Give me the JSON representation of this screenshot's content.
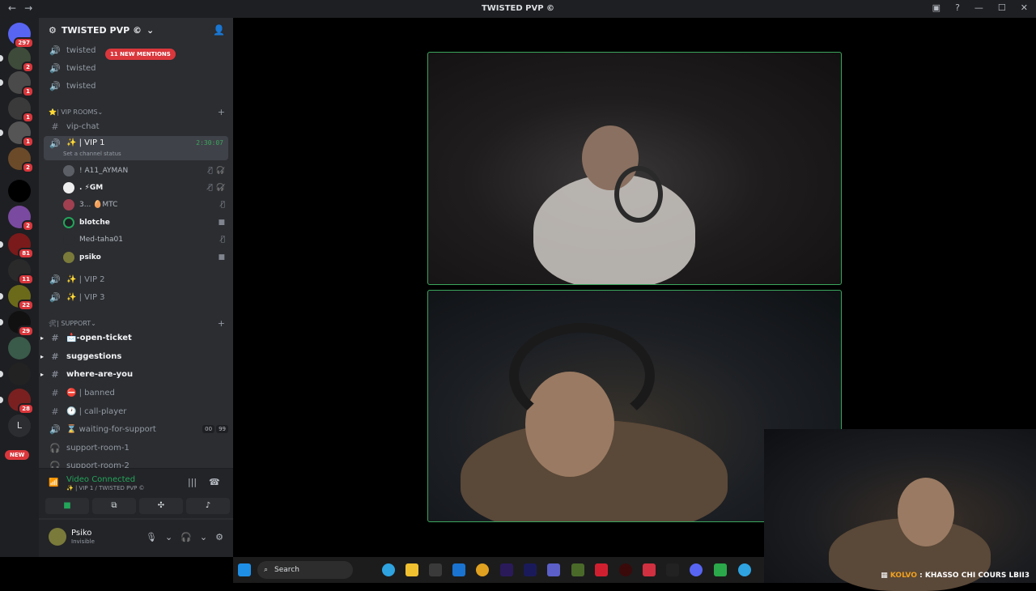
{
  "window": {
    "title": "TWISTED PVP ©"
  },
  "servers": [
    {
      "badge": "297"
    },
    {
      "badge": "2"
    },
    {
      "badge": "1"
    },
    {
      "badge": "1"
    },
    {
      "badge": "1"
    },
    {
      "badge": "2"
    },
    {
      "badge": ""
    },
    {
      "badge": "2"
    },
    {
      "badge": "81"
    },
    {
      "badge": "11"
    },
    {
      "badge": "22"
    },
    {
      "badge": "29"
    },
    {
      "badge": ""
    },
    {
      "badge": ""
    },
    {
      "badge": "28"
    }
  ],
  "rail": {
    "letter": "L",
    "new_label": "NEW"
  },
  "guild": {
    "name": "TWISTED PVP ©"
  },
  "mentions": "11 NEW MENTIONS",
  "channels_top": [
    "twisted",
    "twisted",
    "twisted"
  ],
  "vip_category": "⭐| VIP ROOMS",
  "vip_chat": "vip-chat",
  "vip1": {
    "name": "✨ | VIP 1",
    "status": "Set a channel status",
    "timer": "2:30:07"
  },
  "members": [
    {
      "name": "! A11_AYMAN"
    },
    {
      "name": ". ⚡GM"
    },
    {
      "name": "3... 🥚MTC"
    },
    {
      "name": "blotche"
    },
    {
      "name": "Med-taha01"
    },
    {
      "name": "psiko"
    }
  ],
  "vip_rooms": [
    "✨ | VIP 2",
    "✨ | VIP 3"
  ],
  "support_category": "🛠| SUPPORT",
  "support_channels": [
    {
      "name": "📩-open-ticket"
    },
    {
      "name": "suggestions"
    },
    {
      "name": "where-are-you"
    },
    {
      "name": "⛔ | banned"
    },
    {
      "name": "🕐 | call-player"
    },
    {
      "name": "⌛ waiting-for-support",
      "counts": [
        "00",
        "99"
      ]
    },
    {
      "name": "support-room-1"
    },
    {
      "name": "support-room-2"
    }
  ],
  "voice_panel": {
    "status": "Video Connected",
    "location": "✨ | VIP 1 / TWISTED PVP ©"
  },
  "user": {
    "name": "Psiko",
    "status": "Invisible"
  },
  "taskbar": {
    "search": "Search"
  },
  "overlay": {
    "caption_highlight": "KOLVO",
    "caption_text": " : KHASSO CHI COURS LBII3"
  },
  "colors": {
    "accent_green": "#23a55a",
    "danger": "#da373c",
    "sidebar": "#2b2d31",
    "rail": "#1e1f22"
  }
}
